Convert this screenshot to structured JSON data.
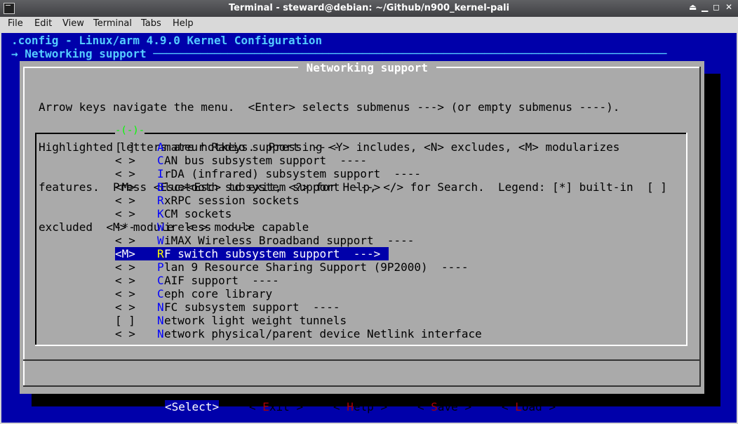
{
  "window": {
    "title": "Terminal - steward@debian: ~/Github/n900_kernel-pali",
    "controls": [
      "⏏",
      "▁",
      "◻",
      "✕"
    ]
  },
  "menubar": [
    "File",
    "Edit",
    "View",
    "Terminal",
    "Tabs",
    "Help"
  ],
  "terminal": {
    "config_line": ".config - Linux/arm 4.9.0 Kernel Configuration",
    "breadcrumb": "→ Networking support ────────────────────────────────────────────────────────────────────────────"
  },
  "dialog": {
    "title": " Networking support ",
    "help_lines": [
      "Arrow keys navigate the menu.  <Enter> selects submenus ---> (or empty submenus ----).",
      "Highlighted letters are hotkeys.  Pressing <Y> includes, <N> excludes, <M> modularizes",
      "features.  Press <Esc><Esc> to exit, <?> for Help, </> for Search.  Legend: [*] built-in  [ ]",
      "excluded  <M> module  < > module capable"
    ],
    "scroll_indicator": "-(-)-",
    "items": [
      {
        "mark": "[ ]",
        "hotkey": "A",
        "label": "mateur Radio support  ----"
      },
      {
        "mark": "< >",
        "hotkey": "C",
        "label": "AN bus subsystem support  ----"
      },
      {
        "mark": "< >",
        "hotkey": "I",
        "label": "rDA (infrared) subsystem support  ----"
      },
      {
        "mark": "<M>",
        "hotkey": "B",
        "label": "luetooth subsystem support  --->"
      },
      {
        "mark": "< >",
        "hotkey": "R",
        "label": "xRPC session sockets"
      },
      {
        "mark": "< >",
        "hotkey": "K",
        "label": "CM sockets"
      },
      {
        "mark": "-*-",
        "hotkey": "W",
        "label": "ireless  --->"
      },
      {
        "mark": "< >",
        "hotkey": "W",
        "label": "iMAX Wireless Broadband support  ----"
      },
      {
        "mark": "<M>",
        "hotkey": "R",
        "label": "F switch subsystem support  --->"
      },
      {
        "mark": "< >",
        "hotkey": "P",
        "label": "lan 9 Resource Sharing Support (9P2000)  ----"
      },
      {
        "mark": "< >",
        "hotkey": "C",
        "label": "AIF support  ----"
      },
      {
        "mark": "< >",
        "hotkey": "C",
        "label": "eph core library"
      },
      {
        "mark": "< >",
        "hotkey": "N",
        "label": "FC subsystem support  ----"
      },
      {
        "mark": "[ ]",
        "hotkey": "N",
        "label": "etwork light weight tunnels"
      },
      {
        "mark": "< >",
        "hotkey": "N",
        "label": "etwork physical/parent device Netlink interface"
      }
    ],
    "buttons": [
      {
        "pre": "<",
        "hk": "S",
        "post": "elect>"
      },
      {
        "pre": "< ",
        "hk": "E",
        "post": "xit >"
      },
      {
        "pre": "< ",
        "hk": "H",
        "post": "elp >"
      },
      {
        "pre": "< ",
        "hk": "S",
        "post": "ave >"
      },
      {
        "pre": "< ",
        "hk": "L",
        "post": "oad >"
      }
    ]
  }
}
